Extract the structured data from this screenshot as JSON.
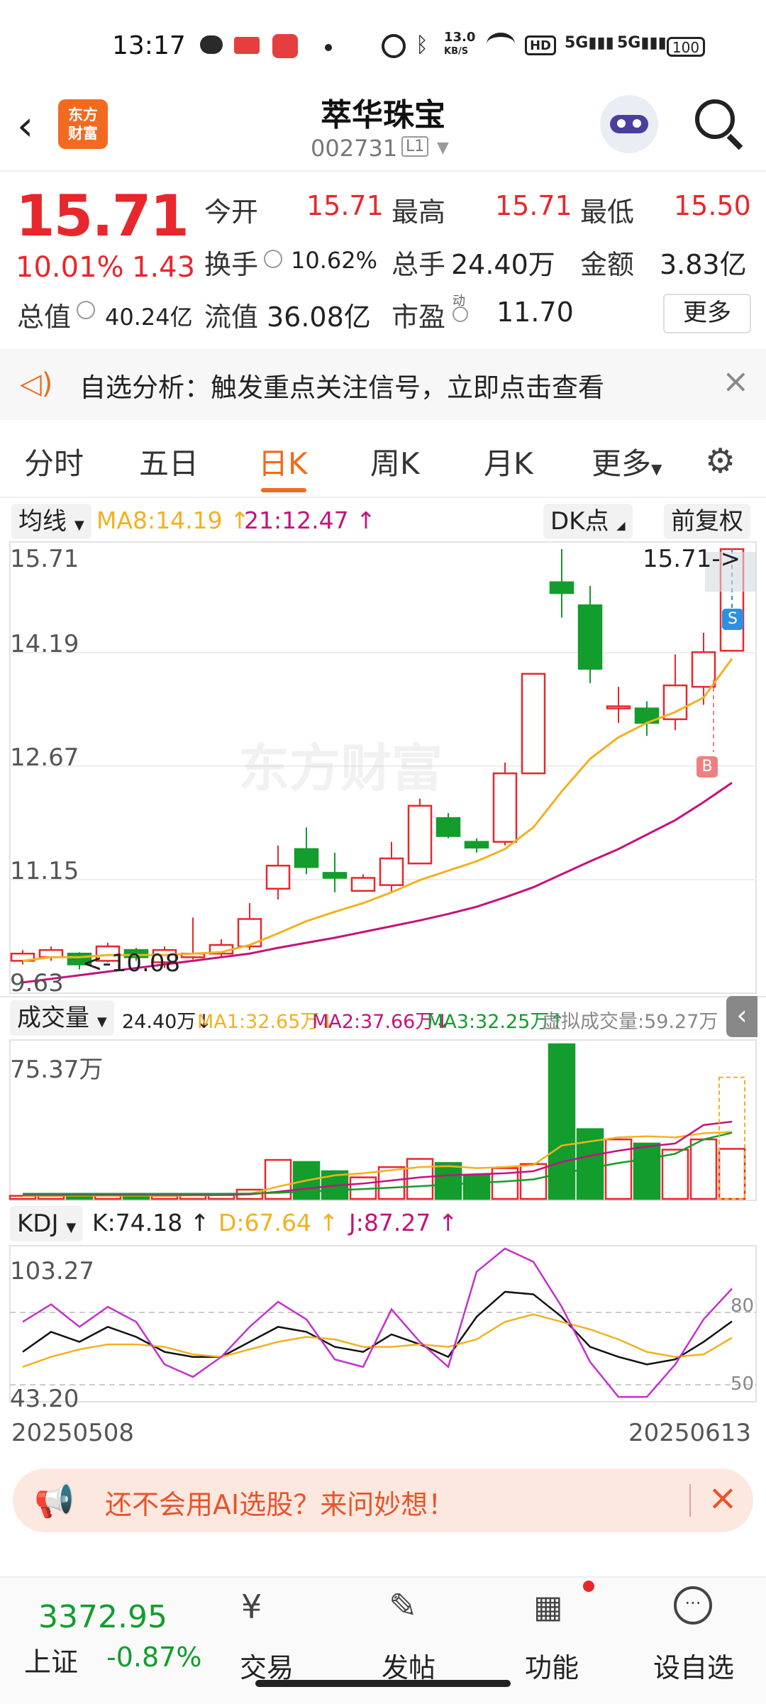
{
  "status_bar": {
    "time": "13:17",
    "net_speed": "13.0",
    "net_unit": "KB/S",
    "battery": "100"
  },
  "header": {
    "back_icon": "back-arrow-icon",
    "logo_text": "东方\n财富",
    "name": "萃华珠宝",
    "code": "002731",
    "level": "L1"
  },
  "quote": {
    "price": "15.71",
    "change_pct": "10.01%",
    "change_amt": "1.43",
    "open_label": "今开",
    "open": "15.71",
    "high_label": "最高",
    "high": "15.71",
    "low_label": "最低",
    "low": "15.50",
    "turnover_label": "换手",
    "turnover": "10.62%",
    "volume_label": "总手",
    "volume": "24.40万",
    "amount_label": "金额",
    "amount": "3.83亿",
    "mcap_label": "总值",
    "mcap": "40.24亿",
    "float_label": "流值",
    "float_cap": "36.08亿",
    "pe_label": "市盈",
    "pe_sup": "动",
    "pe": "11.70",
    "more": "更多"
  },
  "notice": {
    "text": "自选分析：触发重点关注信号，立即点击查看",
    "close": "×"
  },
  "tabs": [
    "分时",
    "五日",
    "日K",
    "周K",
    "月K",
    "更多"
  ],
  "active_tab": "日K",
  "ma_bar": {
    "select": "均线",
    "ma8": "MA8:14.19",
    "ma21": "21:12.47",
    "dk": "DK点",
    "fq": "前复权"
  },
  "kline": {
    "y_ticks": [
      "15.71",
      "14.19",
      "12.67",
      "11.15",
      "9.63"
    ],
    "last_label": "15.71->",
    "low_label": "<-10.08",
    "watermark": "东方财富",
    "sell": "S",
    "buy": "B"
  },
  "volume_bar": {
    "select": "成交量",
    "vol": "24.40万",
    "ma1": "MA1:32.65万",
    "ma2": "MA2:37.66万",
    "ma3": "MA3:32.25万",
    "virtual": "虚拟成交量:59.27万",
    "y_max": "75.37万"
  },
  "kdj_bar": {
    "select": "KDJ",
    "k": "K:74.18",
    "d": "D:67.64",
    "j": "J:87.27",
    "y_max": "103.27",
    "y_min": "43.20",
    "lvl80": "80",
    "lvl50": "50"
  },
  "dates": {
    "start": "20250508",
    "end": "20250613"
  },
  "banner": {
    "text": "还不会用AI选股？来问妙想！"
  },
  "bottom_nav": {
    "index_value": "3372.95",
    "index_name": "上证",
    "index_change": "-0.87%",
    "trade": "交易",
    "post": "发帖",
    "func": "功能",
    "watch": "设自选"
  },
  "colors": {
    "up": "#e8272c",
    "down": "#129d2c",
    "accent": "#f06a1c",
    "ma8": "#f2b120",
    "ma21": "#c3137c"
  },
  "chart_data": {
    "type": "candlestick",
    "candles": [
      {
        "o": 10.0,
        "c": 10.1,
        "h": 10.15,
        "l": 9.95
      },
      {
        "o": 10.05,
        "c": 10.15,
        "h": 10.2,
        "l": 10.0
      },
      {
        "o": 10.1,
        "c": 9.95,
        "h": 10.12,
        "l": 9.88
      },
      {
        "o": 10.0,
        "c": 10.2,
        "h": 10.25,
        "l": 9.98
      },
      {
        "o": 10.15,
        "c": 10.05,
        "h": 10.18,
        "l": 10.0
      },
      {
        "o": 9.98,
        "c": 10.15,
        "h": 10.2,
        "l": 9.9
      },
      {
        "o": 10.05,
        "c": 10.1,
        "h": 10.6,
        "l": 10.02
      },
      {
        "o": 10.1,
        "c": 10.22,
        "h": 10.3,
        "l": 10.05
      },
      {
        "o": 10.2,
        "c": 10.58,
        "h": 10.8,
        "l": 10.15
      },
      {
        "o": 11.0,
        "c": 11.32,
        "h": 11.6,
        "l": 10.85
      },
      {
        "o": 11.55,
        "c": 11.3,
        "h": 11.85,
        "l": 11.2
      },
      {
        "o": 11.22,
        "c": 11.15,
        "h": 11.5,
        "l": 10.95
      },
      {
        "o": 10.97,
        "c": 11.15,
        "h": 11.2,
        "l": 10.97
      },
      {
        "o": 11.05,
        "c": 11.42,
        "h": 11.65,
        "l": 10.95
      },
      {
        "o": 11.35,
        "c": 12.15,
        "h": 12.25,
        "l": 11.35
      },
      {
        "o": 11.98,
        "c": 11.73,
        "h": 12.05,
        "l": 11.7
      },
      {
        "o": 11.65,
        "c": 11.57,
        "h": 11.7,
        "l": 11.5
      },
      {
        "o": 11.65,
        "c": 12.6,
        "h": 12.75,
        "l": 11.6
      },
      {
        "o": 12.6,
        "c": 13.98,
        "h": 13.98,
        "l": 12.6
      },
      {
        "o": 15.25,
        "c": 15.1,
        "h": 15.71,
        "l": 14.76
      },
      {
        "o": 14.93,
        "c": 14.05,
        "h": 15.2,
        "l": 13.85
      },
      {
        "o": 13.53,
        "c": 13.53,
        "h": 13.8,
        "l": 13.3
      },
      {
        "o": 13.5,
        "c": 13.3,
        "h": 13.6,
        "l": 13.12
      },
      {
        "o": 13.35,
        "c": 13.82,
        "h": 14.25,
        "l": 13.2
      },
      {
        "o": 13.8,
        "c": 14.28,
        "h": 14.55,
        "l": 13.55
      },
      {
        "o": 14.3,
        "c": 15.71,
        "h": 15.71,
        "l": 15.5
      }
    ],
    "ma8": [
      10.0,
      10.05,
      10.05,
      10.08,
      10.08,
      10.08,
      10.1,
      10.12,
      10.22,
      10.38,
      10.55,
      10.68,
      10.8,
      10.95,
      11.12,
      11.25,
      11.38,
      11.55,
      11.85,
      12.35,
      12.8,
      13.1,
      13.3,
      13.45,
      13.65,
      14.19
    ],
    "ma21": [
      9.7,
      9.75,
      9.8,
      9.85,
      9.9,
      9.95,
      10.0,
      10.05,
      10.1,
      10.18,
      10.25,
      10.32,
      10.4,
      10.48,
      10.56,
      10.65,
      10.75,
      10.88,
      11.02,
      11.2,
      11.38,
      11.55,
      11.75,
      11.95,
      12.2,
      12.47
    ],
    "volume": [
      1.5,
      1.5,
      1.6,
      1.6,
      1.5,
      1.5,
      1.8,
      1.9,
      4.5,
      19.0,
      18.0,
      13.5,
      10.5,
      15.5,
      19.5,
      17.5,
      11.5,
      15.0,
      17.0,
      75.37,
      34.0,
      29.0,
      27.0,
      24.0,
      29.0,
      24.4
    ],
    "kdj_k": [
      62,
      70,
      66,
      72,
      68,
      62,
      60,
      60,
      66,
      72,
      70,
      64,
      62,
      69,
      65,
      60,
      76,
      86,
      85,
      76,
      64,
      60,
      57,
      59,
      66,
      74.18
    ],
    "kdj_d": [
      56,
      60,
      63,
      65,
      65,
      64,
      61,
      60,
      63,
      66,
      68,
      67,
      64,
      64,
      65,
      64,
      67,
      74,
      77,
      74,
      71,
      67,
      62,
      60,
      61,
      67.64
    ],
    "kdj_j": [
      74,
      81,
      72,
      80,
      74,
      57,
      52,
      60,
      72,
      82,
      75,
      59,
      56,
      79,
      66,
      56,
      94,
      103.27,
      98,
      80,
      58,
      44,
      44,
      57,
      75,
      87.27
    ]
  }
}
